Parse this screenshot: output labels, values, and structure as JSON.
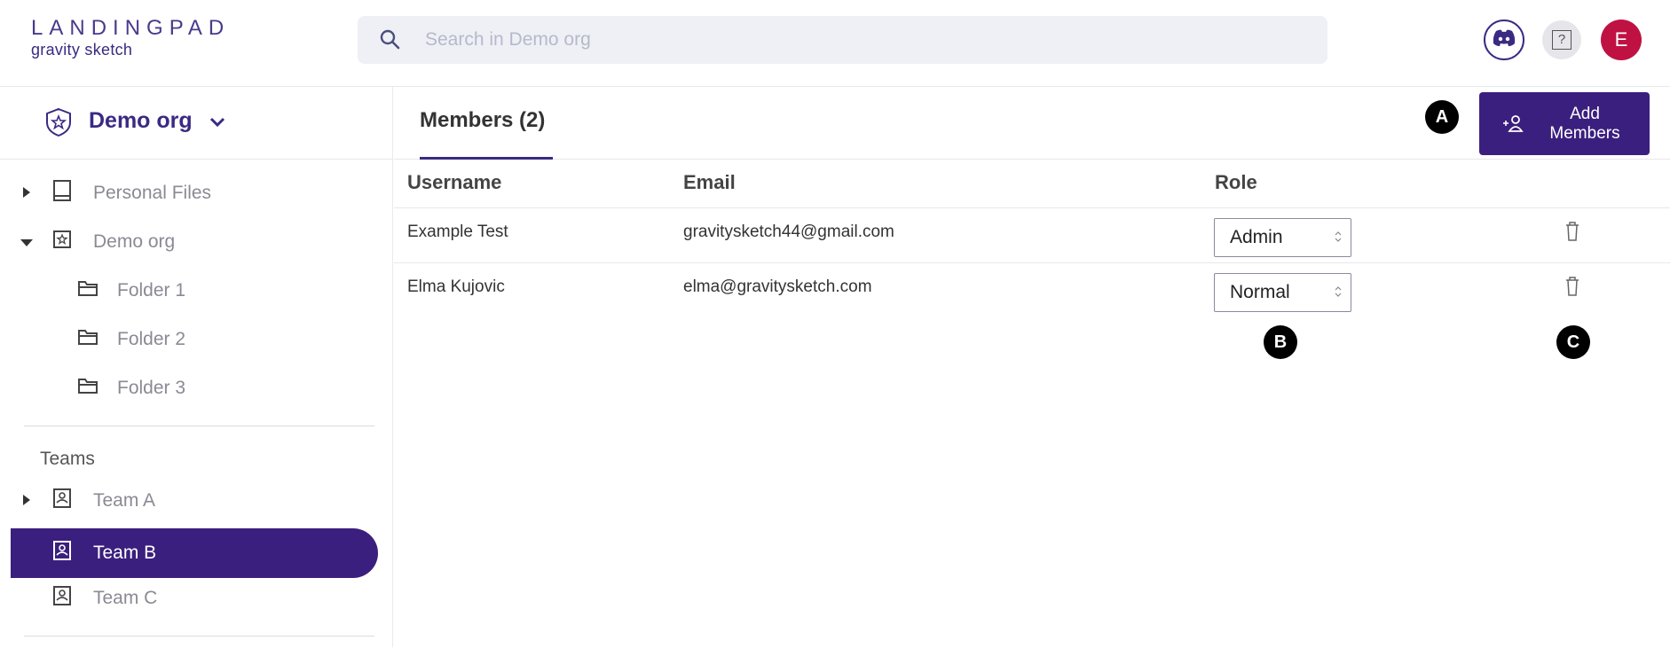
{
  "header": {
    "logo_top": "LANDINGPAD",
    "logo_bottom": "gravity sketch",
    "search_placeholder": "Search in Demo org",
    "avatar_initial": "E",
    "help_glyph": "?"
  },
  "sidebar": {
    "org_name": "Demo org",
    "tree": [
      {
        "label": "Personal Files",
        "icon": "tablet-icon",
        "expanded": false
      },
      {
        "label": "Demo org",
        "icon": "org-icon",
        "expanded": true
      },
      {
        "label": "Folder 1",
        "icon": "folder-icon"
      },
      {
        "label": "Folder 2",
        "icon": "folder-icon"
      },
      {
        "label": "Folder 3",
        "icon": "folder-icon"
      }
    ],
    "teams_heading": "Teams",
    "teams": [
      {
        "label": "Team A",
        "selected": false,
        "has_children": true
      },
      {
        "label": "Team B",
        "selected": true,
        "has_children": false
      },
      {
        "label": "Team C",
        "selected": false,
        "has_children": false
      }
    ]
  },
  "main": {
    "tab_label": "Members (2)",
    "add_button": {
      "line1": "Add",
      "line2": "Members"
    },
    "markers": {
      "a": "A",
      "b": "B",
      "c": "C"
    },
    "columns": [
      "Username",
      "Email",
      "Role"
    ],
    "rows": [
      {
        "username": "Example Test",
        "email": "gravitysketch44@gmail.com",
        "role": "Admin"
      },
      {
        "username": "Elma Kujovic",
        "email": "elma@gravitysketch.com",
        "role": "Normal"
      }
    ]
  },
  "colors": {
    "brand": "#3b1f7e",
    "avatar": "#bf1242",
    "search_bg": "#eef0f6"
  }
}
